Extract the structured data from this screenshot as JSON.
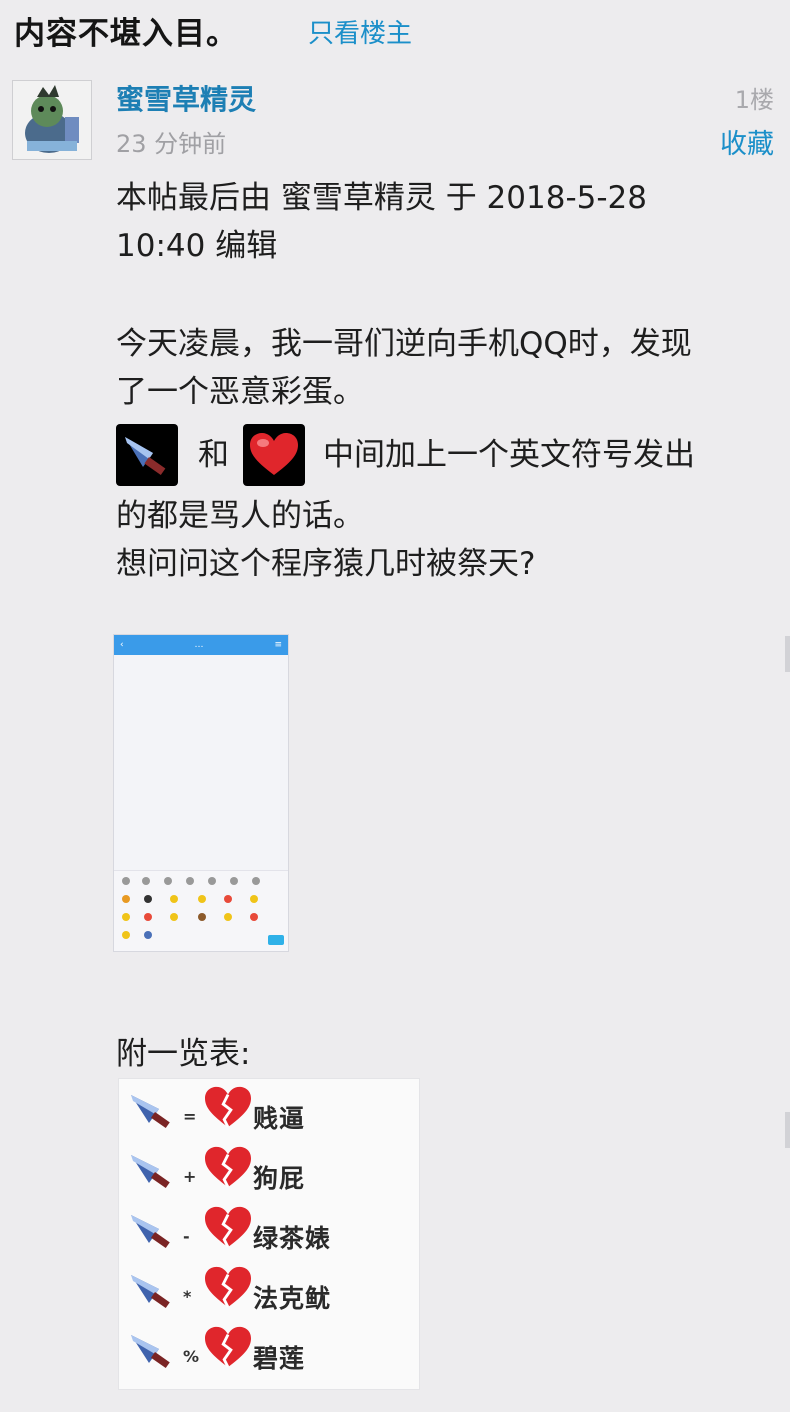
{
  "header": {
    "title": "内容不堪入目。",
    "only_op_link": "只看楼主"
  },
  "post": {
    "username": "蜜雪草精灵",
    "floor": "1楼",
    "time": "23 分钟前",
    "favorite_label": "收藏",
    "edit_note_line1": "本帖最后由 蜜雪草精灵 于 2018-5-28",
    "edit_note_line2": "10:40 编辑",
    "para1_line1": "今天凌晨，我一哥们逆向手机QQ时，发现",
    "para1_line2": "了一个恶意彩蛋。",
    "emoji_and": "和",
    "emoji_line_rest": "中间加上一个英文符号发出",
    "para2_line2": "的都是骂人的话。",
    "question": "想问问这个程序猿几时被祭天?",
    "list_heading": "附一览表:",
    "icons": {
      "knife": "kitchen-knife-icon",
      "heart": "red-heart-icon",
      "broken_heart": "broken-heart-icon"
    }
  },
  "table": {
    "rows": [
      {
        "symbol": "=",
        "word": "贱逼"
      },
      {
        "symbol": "+",
        "word": "狗屁"
      },
      {
        "symbol": "-",
        "word": "绿茶婊"
      },
      {
        "symbol": "*",
        "word": "法克鱿"
      },
      {
        "symbol": "%",
        "word": "碧莲"
      }
    ]
  },
  "colors": {
    "link": "#1b8fc9",
    "username": "#1d7fb4",
    "background": "#edecee",
    "heart": "#e0262c"
  }
}
